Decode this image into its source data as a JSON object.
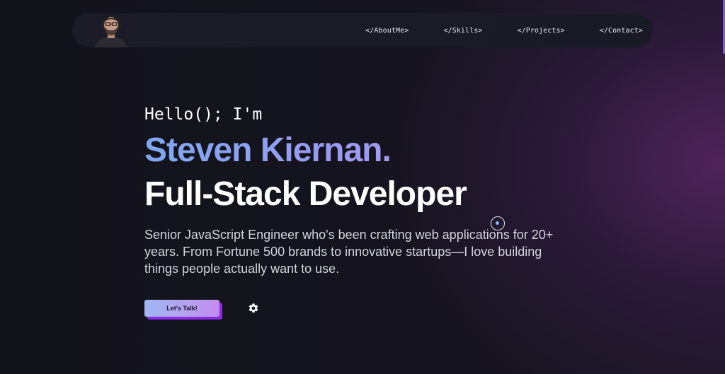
{
  "nav": {
    "avatar_alt": "Steven Kiernan",
    "links": [
      {
        "label": "</AboutMe>"
      },
      {
        "label": "</Skills>"
      },
      {
        "label": "</Projects>"
      },
      {
        "label": "</Contact>"
      }
    ]
  },
  "hero": {
    "greeting": "Hello(); I'm",
    "name": "Steven Kiernan.",
    "role": "Full-Stack Developer",
    "bio": "Senior JavaScript Engineer who's been crafting web applications for 20+ years. From Fortune 500 brands to innovative startups—I love building things people actually want to use.",
    "cta_label": "Let's Talk!"
  },
  "icons": {
    "settings": "gear-icon",
    "cursor": "cursor-ring-icon"
  },
  "colors": {
    "background": "#14141c",
    "name_gradient_start": "#7ea8f0",
    "name_gradient_end": "#b79cf2",
    "cta_shadow": "#8a2be2",
    "accent": "#7d5cd6"
  }
}
